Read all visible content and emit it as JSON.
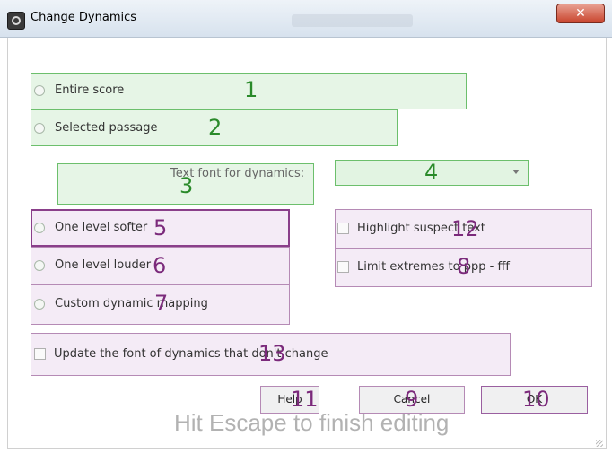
{
  "window": {
    "title": "Change Dynamics",
    "close_glyph": "✕"
  },
  "scope": {
    "entire_score_label": "Entire score",
    "selected_passage_label": "Selected passage"
  },
  "font": {
    "label": "Text font for dynamics:",
    "value": ""
  },
  "mode": {
    "softer_label": "One level softer",
    "louder_label": "One level louder",
    "custom_label": "Custom dynamic mapping"
  },
  "options": {
    "highlight_label": "Highlight suspect text",
    "limit_label": "Limit extremes to ppp - fff",
    "update_font_label": "Update the font of dynamics that don't change"
  },
  "buttons": {
    "help": "Help",
    "cancel": "Cancel",
    "ok": "OK"
  },
  "hint": "Hit Escape to finish editing",
  "markers": {
    "m1": "1",
    "m2": "2",
    "m3": "3",
    "m4": "4",
    "m5": "5",
    "m6": "6",
    "m7": "7",
    "m8": "8",
    "m9": "9",
    "m10": "10",
    "m11": "11",
    "m12": "12",
    "m13": "13"
  },
  "colors": {
    "green_accent": "#2a8a2a",
    "purple_accent": "#7b2a7b",
    "close_red": "#c9452e"
  }
}
